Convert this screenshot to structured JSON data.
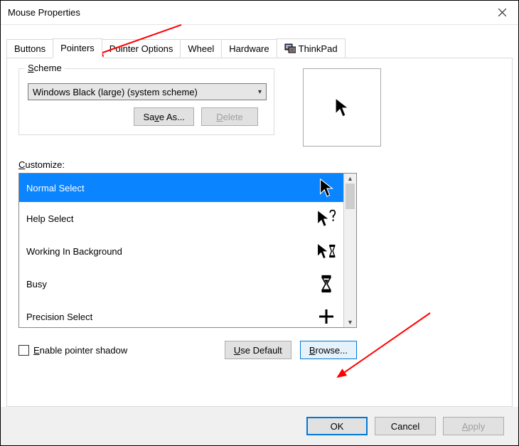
{
  "window": {
    "title": "Mouse Properties"
  },
  "tabs": [
    {
      "label": "Buttons"
    },
    {
      "label": "Pointers"
    },
    {
      "label": "Pointer Options"
    },
    {
      "label": "Wheel"
    },
    {
      "label": "Hardware"
    },
    {
      "label": "ThinkPad"
    }
  ],
  "scheme": {
    "legend_prefix": "S",
    "legend_rest": "cheme",
    "selected": "Windows Black (large) (system scheme)",
    "save_btn_prefix": "Sa",
    "save_btn_u": "v",
    "save_btn_suffix": "e As...",
    "delete_btn_u": "D",
    "delete_btn_rest": "elete"
  },
  "customize": {
    "label_u": "C",
    "label_rest": "ustomize:",
    "items": [
      {
        "name": "Normal Select",
        "icon": "cursor-arrow"
      },
      {
        "name": "Help Select",
        "icon": "cursor-help"
      },
      {
        "name": "Working In Background",
        "icon": "cursor-working"
      },
      {
        "name": "Busy",
        "icon": "cursor-busy"
      },
      {
        "name": "Precision Select",
        "icon": "cursor-precision"
      }
    ]
  },
  "pointer_shadow": {
    "prefix": "",
    "u": "E",
    "rest": "nable pointer shadow"
  },
  "buttons": {
    "use_default_prefix": "",
    "use_default_u": "U",
    "use_default_rest": "se Default",
    "browse_u": "B",
    "browse_rest": "rowse...",
    "ok": "OK",
    "cancel": "Cancel",
    "apply_u": "A",
    "apply_rest": "pply"
  }
}
